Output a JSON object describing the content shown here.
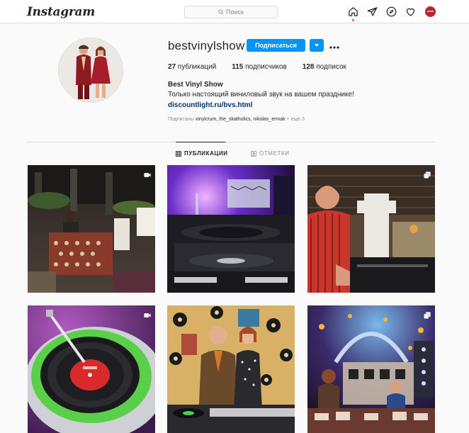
{
  "header": {
    "logo": "Instagram",
    "search_placeholder": "Поиск",
    "icons": [
      "home-icon",
      "direct-icon",
      "explore-icon",
      "activity-icon",
      "profile-avatar"
    ]
  },
  "profile": {
    "username": "bestvinylshow",
    "follow_label": "Подписаться",
    "stats": [
      {
        "count": "27",
        "label": "публикаций"
      },
      {
        "count": "115",
        "label": "подписчиков"
      },
      {
        "count": "128",
        "label": "подписок"
      }
    ],
    "full_name": "Best Vinyl Show",
    "bio": "Только настоящий виниловый звук на вашем празднике!",
    "link": "discountlight.ru/bvs.html",
    "followed_by_prefix": "Подписаны",
    "followed_by_names": "vinylcrum, the_skatholics, nikolas_ermak",
    "followed_by_more": "+ еще 3"
  },
  "tabs": {
    "posts": "ПУБЛИКАЦИИ",
    "tagged": "ОТМЕТКИ"
  },
  "posts": [
    {
      "type": "video"
    },
    {
      "type": "photo"
    },
    {
      "type": "carousel"
    },
    {
      "type": "video"
    },
    {
      "type": "photo"
    },
    {
      "type": "carousel"
    }
  ],
  "colors": {
    "accent": "#0095f6",
    "link": "#00376b",
    "notification": "#ed4956"
  }
}
